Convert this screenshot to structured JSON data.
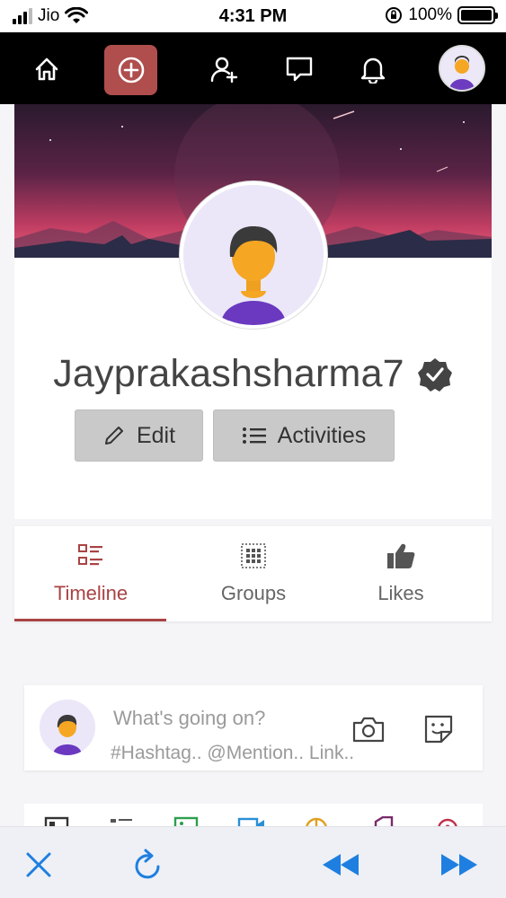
{
  "status_bar": {
    "carrier": "Jio",
    "time": "4:31 PM",
    "battery": "100%",
    "battery_level": 1.0
  },
  "top_nav": {
    "items": [
      "home-icon",
      "add-circle-icon",
      "add-friend-icon",
      "messages-icon",
      "notifications-icon",
      "avatar"
    ],
    "accent": "#b04e4e"
  },
  "profile": {
    "username": "Jayprakashsharma7",
    "verified": true,
    "edit_label": "Edit",
    "activities_label": "Activities"
  },
  "tabs": [
    {
      "label": "Timeline",
      "icon": "timeline-icon",
      "active": true
    },
    {
      "label": "Groups",
      "icon": "groups-icon",
      "active": false
    },
    {
      "label": "Likes",
      "icon": "thumbs-up-icon",
      "active": false
    }
  ],
  "composer": {
    "placeholder": "What's going on?",
    "hint": "#Hashtag.. @Mention.. Link.."
  },
  "colors": {
    "active_tab": "#a94343",
    "bottom_bar_icons": "#1f7fe0"
  }
}
